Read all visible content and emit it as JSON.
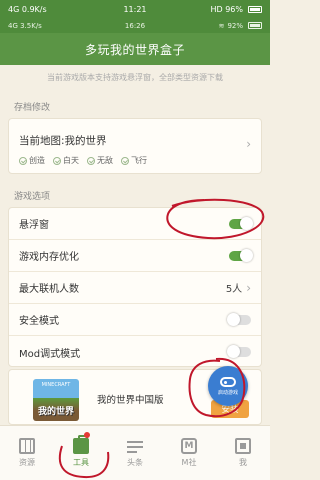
{
  "status_outer": {
    "left": "4G 0.9K/s",
    "time": "11:21",
    "right": "HD 96%"
  },
  "status_inner": {
    "left": "4G 3.5K/s",
    "time": "16:26",
    "right": "92%"
  },
  "header": {
    "title": "多玩我的世界盒子"
  },
  "notice": "当前游戏版本支持游戏悬浮窗，全部类型资源下载",
  "save_section": {
    "title": "存档修改",
    "current_map": "当前地图:我的世界",
    "tags": [
      "创造",
      "白天",
      "无敌",
      "飞行"
    ]
  },
  "options_section": {
    "title": "游戏选项",
    "rows": [
      {
        "label": "悬浮窗",
        "type": "toggle",
        "on": true
      },
      {
        "label": "游戏内存优化",
        "type": "toggle",
        "on": true
      },
      {
        "label": "最大联机人数",
        "type": "value",
        "value": "5人"
      },
      {
        "label": "安全模式",
        "type": "toggle",
        "on": false
      },
      {
        "label": "Mod调式模式",
        "type": "toggle",
        "on": false
      }
    ]
  },
  "game_card": {
    "name": "我的世界中国版",
    "install": "安装",
    "thumb_small": "MINECRAFT",
    "thumb_text": "我的世界"
  },
  "float_bubble": {
    "label": "启动游戏"
  },
  "tabs": [
    {
      "label": "资源",
      "icon": "map-icon",
      "active": false
    },
    {
      "label": "工具",
      "icon": "toolbox-icon",
      "active": true,
      "badge": true
    },
    {
      "label": "头条",
      "icon": "news-icon",
      "active": false
    },
    {
      "label": "M社",
      "icon": "m-icon",
      "active": false
    },
    {
      "label": "我",
      "icon": "me-icon",
      "active": false
    }
  ],
  "colors": {
    "brand": "#5b9545",
    "toggle_on": "#5fa545",
    "install": "#f0a341",
    "annotation": "#c0172b",
    "bubble": "#3a7dd1"
  }
}
